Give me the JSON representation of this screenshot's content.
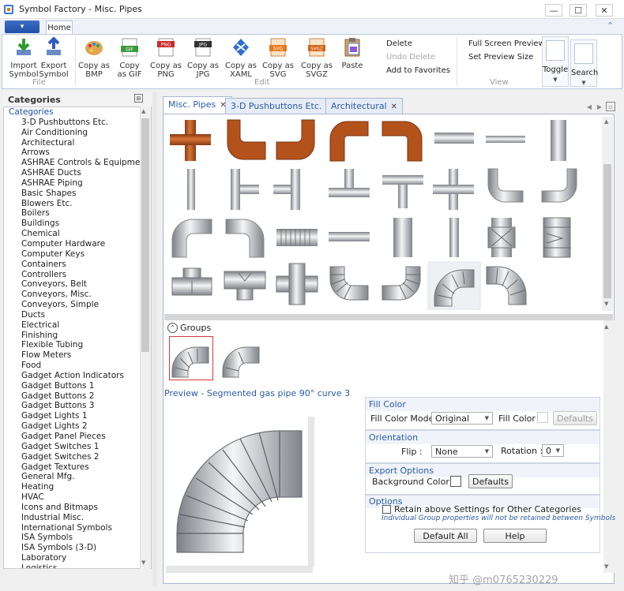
{
  "window": {
    "title": "Symbol Factory - Misc. Pipes"
  },
  "ribbon": {
    "tab_home": "Home",
    "groups": {
      "file": "File",
      "edit": "Edit",
      "view": "View"
    },
    "buttons": {
      "import_symbol": "Import\nSymbol",
      "export_symbol": "Export\nSymbol",
      "copy_bmp": "Copy as\nBMP",
      "copy_gif": "Copy\nas GIF",
      "copy_png": "Copy as\nPNG",
      "copy_jpg": "Copy as\nJPG",
      "copy_xaml": "Copy as\nXAML",
      "copy_svg": "Copy as\nSVG",
      "copy_svgz": "Copy as\nSVGZ",
      "paste": "Paste",
      "delete": "Delete",
      "undo_delete": "Undo Delete",
      "add_favorites": "Add to Favorites",
      "full_screen": "Full Screen Preview",
      "set_preview": "Set Preview Size",
      "toggle": "Toggle",
      "search": "Search"
    },
    "icon_badges": {
      "gif": "GIF",
      "png": "PNG",
      "jpg": "JPG",
      "svg": "SVG",
      "svgz": "SVGZ"
    }
  },
  "categories": {
    "header": "Categories",
    "root": "Categories",
    "items": [
      "3-D Pushbuttons Etc.",
      "Air Conditioning",
      "Architectural",
      "Arrows",
      "ASHRAE Controls & Equipment",
      "ASHRAE Ducts",
      "ASHRAE Piping",
      "Basic Shapes",
      "Blowers Etc.",
      "Boilers",
      "Buildings",
      "Chemical",
      "Computer Hardware",
      "Computer Keys",
      "Containers",
      "Controllers",
      "Conveyors, Belt",
      "Conveyors, Misc.",
      "Conveyors, Simple",
      "Ducts",
      "Electrical",
      "Finishing",
      "Flexible Tubing",
      "Flow Meters",
      "Food",
      "Gadget Action Indicators",
      "Gadget Buttons 1",
      "Gadget Buttons 2",
      "Gadget Buttons 3",
      "Gadget Lights 1",
      "Gadget Lights 2",
      "Gadget Panel Pieces",
      "Gadget Switches 1",
      "Gadget Switches 2",
      "Gadget Textures",
      "General Mfg.",
      "Heating",
      "HVAC",
      "Icons and Bitmaps",
      "Industrial Misc.",
      "International Symbols",
      "ISA Symbols",
      "ISA Symbols (3-D)",
      "Laboratory",
      "Logistics"
    ]
  },
  "tabs": [
    {
      "label": "Misc. Pipes"
    },
    {
      "label": "3-D Pushbuttons Etc."
    },
    {
      "label": "Architectural"
    }
  ],
  "groups_label": "Groups",
  "preview": {
    "label": "Preview - Segmented gas pipe 90° curve 3"
  },
  "fill_color": {
    "legend": "Fill Color",
    "mode_label": "Fill Color Mode",
    "mode_value": "Original",
    "color_label": "Fill Color",
    "defaults": "Defaults"
  },
  "orientation": {
    "legend": "Orientation",
    "flip_label": "Flip :",
    "flip_value": "None",
    "rotation_label": "Rotation :",
    "rotation_value": "0"
  },
  "export_options": {
    "legend": "Export Options",
    "bg_label": "Background Color :",
    "defaults": "Defaults"
  },
  "options": {
    "legend": "Options",
    "retain_label": "Retain above Settings for Other Categories",
    "note": "Individual Group properties will not be retained between Symbols",
    "default_all": "Default All",
    "help": "Help"
  },
  "watermark": "知乎 @m0765230229",
  "colors": {
    "accent": "#2b5aa6",
    "copper": "#b4521c",
    "steel": "#a9adb3"
  }
}
